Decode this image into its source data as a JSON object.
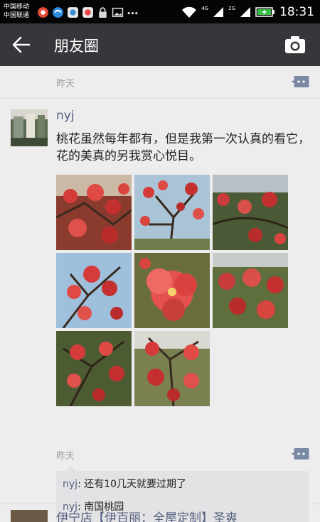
{
  "status_bar": {
    "carrier1": "中国移动",
    "carrier2": "中国联通",
    "network1": "4G",
    "network2": "2G",
    "time": "18:31"
  },
  "navbar": {
    "title": "朋友圈"
  },
  "previous_item": {
    "time": "昨天"
  },
  "post": {
    "author": "nyj",
    "text": "桃花虽然每年都有，但是我第一次认真的看它，花的美真的另我赏心悦目。",
    "photo_count": 8,
    "time": "昨天",
    "comments": [
      {
        "author": "nyj",
        "sep": ": ",
        "text": "还有10几天就要过期了"
      },
      {
        "author": "nyj",
        "sep": ": ",
        "text": "南国桃园"
      }
    ]
  },
  "next_post": {
    "title": "伊宁店【伊百丽：全屋定制】圣爽"
  },
  "colors": {
    "status_bar": "#050505",
    "nav_bar": "#35373b",
    "background": "#ededed",
    "name_link": "#55607f",
    "comment_bg": "#e3e3e5"
  }
}
